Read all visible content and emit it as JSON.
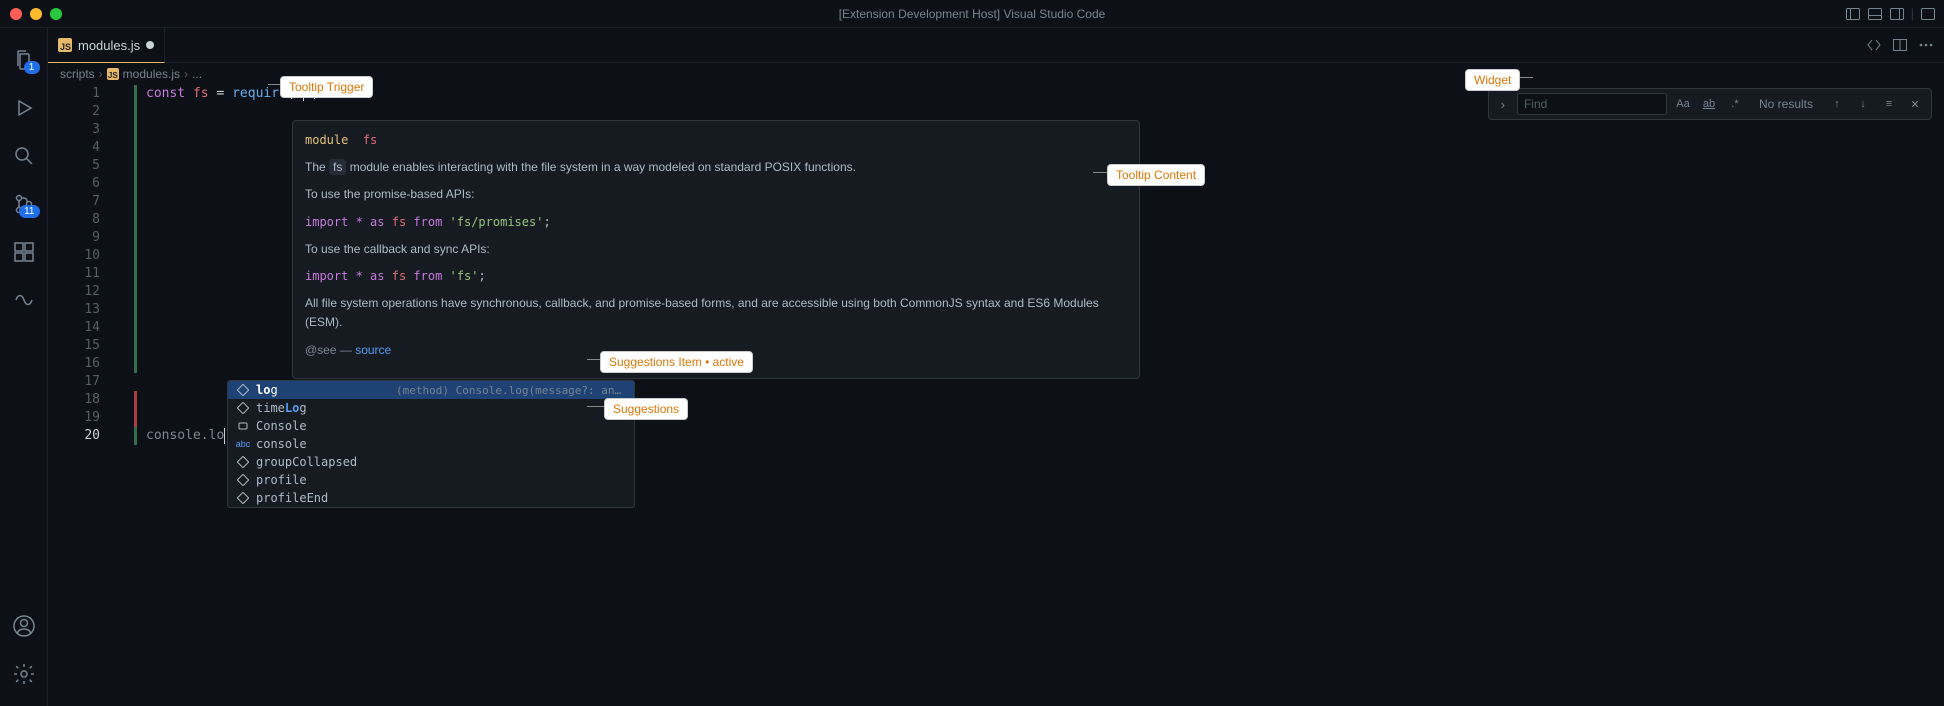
{
  "title_bar": {
    "text": "[Extension Development Host] Visual Studio Code"
  },
  "activity": {
    "explorer_badge": "1",
    "scm_badge": "11"
  },
  "tab": {
    "filename": "modules.js"
  },
  "breadcrumb": {
    "seg1": "scripts",
    "seg2": "modules.js",
    "seg3": "..."
  },
  "code": {
    "line1": {
      "kw": "const",
      "var": "fs",
      "eq": " = ",
      "func": "require",
      "paren": "(",
      "cursor_after": ")"
    },
    "line20_prefix": "console.",
    "line20_typed": "lo"
  },
  "lines": [
    "1",
    "2",
    "3",
    "4",
    "5",
    "6",
    "7",
    "8",
    "9",
    "10",
    "11",
    "12",
    "13",
    "14",
    "15",
    "16",
    "17",
    "18",
    "19",
    "20"
  ],
  "hover": {
    "sig_module": "module",
    "sig_fs": "fs",
    "p1_a": "The ",
    "p1_code": "fs",
    "p1_b": " module enables interacting with the file system in a way modeled on standard POSIX functions.",
    "p2": "To use the promise-based APIs:",
    "imp1": {
      "import": "import ",
      "star": "*",
      "as": " as ",
      "fs": "fs",
      "from": " from ",
      "mod": "'fs/promises'",
      "semi": ";"
    },
    "p3": "To use the callback and sync APIs:",
    "imp2": {
      "import": "import ",
      "star": "*",
      "as": " as ",
      "fs": "fs",
      "from": " from ",
      "mod": "'fs'",
      "semi": ";"
    },
    "p4": "All file system operations have synchronous, callback, and promise-based forms, and are accessible using both CommonJS syntax and ES6 Modules (ESM).",
    "see_a": "@see — ",
    "see_link": "source"
  },
  "suggest": {
    "items": [
      {
        "icon": "method",
        "label_pre": "lo",
        "label_post": "g",
        "detail": "(method) Console.log(message?: any, ...opti…"
      },
      {
        "icon": "method",
        "label_pre": "",
        "label_mid": "time",
        "label_match": "Lo",
        "label_post": "g",
        "detail": ""
      },
      {
        "icon": "variable",
        "label_pre": "",
        "label_post": "Console",
        "detail": ""
      },
      {
        "icon": "abc",
        "label_pre": "",
        "label_post": "console",
        "detail": ""
      },
      {
        "icon": "method",
        "label_pre": "",
        "label_post": "groupCollapsed",
        "detail": ""
      },
      {
        "icon": "method",
        "label_pre": "",
        "label_post": "profile",
        "detail": ""
      },
      {
        "icon": "method",
        "label_pre": "",
        "label_post": "profileEnd",
        "detail": ""
      }
    ]
  },
  "find": {
    "placeholder": "Find",
    "results": "No results"
  },
  "annotations": {
    "tooltip_trigger": "Tooltip Trigger",
    "tooltip_content": "Tooltip Content",
    "widget": "Widget",
    "suggest_item": "Suggestions Item",
    "suggest_item_state": "• active",
    "suggestions": "Suggestions"
  }
}
